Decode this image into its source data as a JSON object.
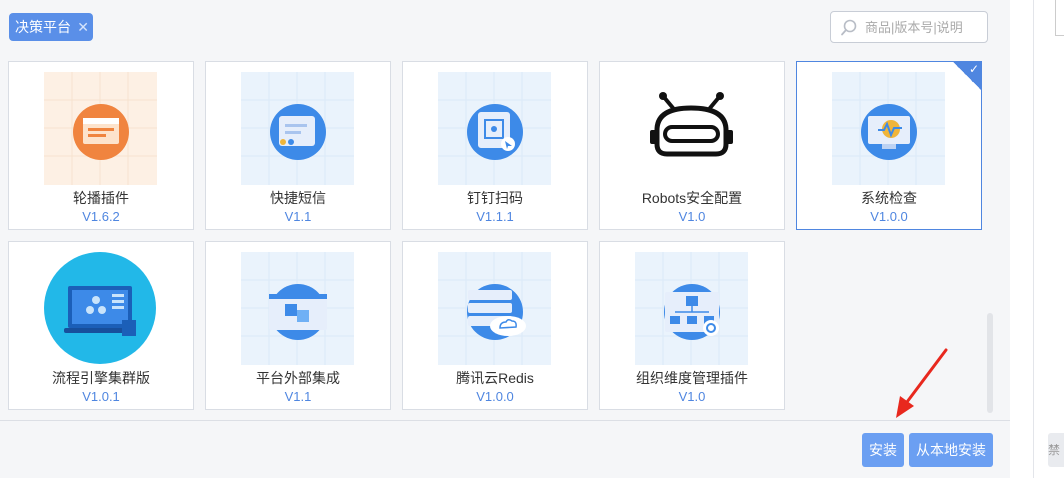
{
  "filter_tag": {
    "label": "决策平台",
    "close": "✕"
  },
  "search": {
    "placeholder": "商品|版本号|说明"
  },
  "plugins": [
    {
      "name": "轮播插件",
      "version": "V1.6.2",
      "icon": "carousel-icon",
      "selected": false
    },
    {
      "name": "快捷短信",
      "version": "V1.1",
      "icon": "message-icon",
      "selected": false
    },
    {
      "name": "钉钉扫码",
      "version": "V1.1.1",
      "icon": "scan-icon",
      "selected": false
    },
    {
      "name": "Robots安全配置",
      "version": "V1.0",
      "icon": "robot-icon",
      "selected": false
    },
    {
      "name": "系统检查",
      "version": "V1.0.0",
      "icon": "monitor-check-icon",
      "selected": true
    },
    {
      "name": "流程引擎集群版",
      "version": "V1.0.1",
      "icon": "workflow-cluster-icon",
      "selected": false
    },
    {
      "name": "平台外部集成",
      "version": "V1.1",
      "icon": "integration-icon",
      "selected": false
    },
    {
      "name": "腾讯云Redis",
      "version": "V1.0.0",
      "icon": "cloud-redis-icon",
      "selected": false
    },
    {
      "name": "组织维度管理插件",
      "version": "V1.0",
      "icon": "org-chart-icon",
      "selected": false
    }
  ],
  "footer": {
    "install_label": "安装",
    "local_install_label": "从本地安装"
  },
  "edge": {
    "button_fragment": "禁"
  },
  "colors": {
    "accent": "#4f86e0",
    "button": "#6b9ff2",
    "tag": "#5a8fe8",
    "arrow": "#e8281e"
  }
}
